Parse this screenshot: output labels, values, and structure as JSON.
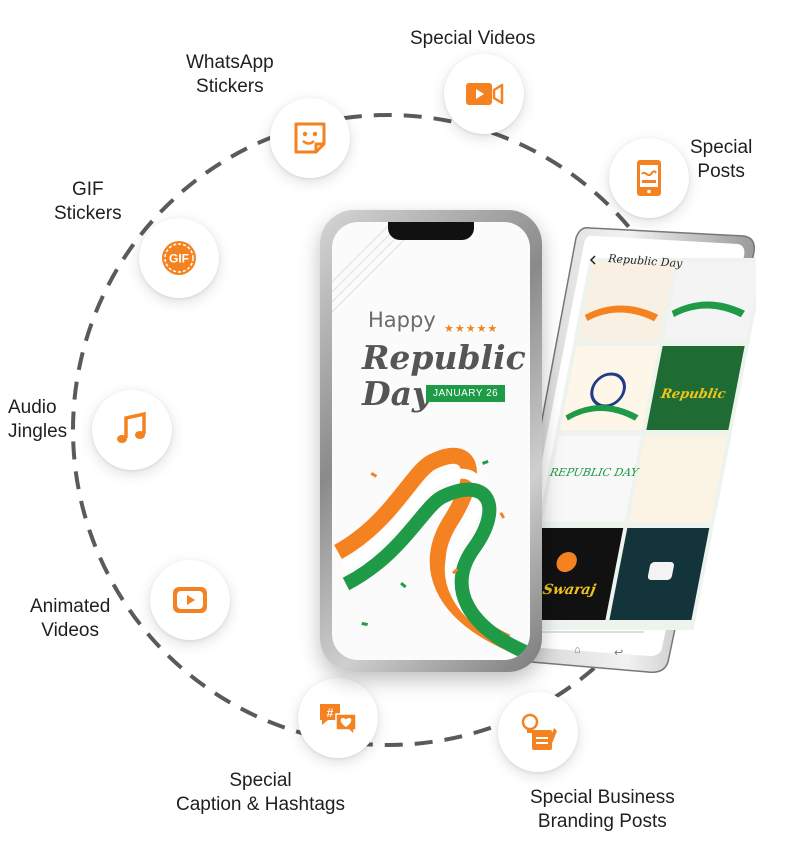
{
  "features": [
    {
      "id": "special-videos",
      "lines": [
        "Special Videos"
      ],
      "icon": "video-camera-icon"
    },
    {
      "id": "special-posts",
      "lines": [
        "Special",
        "Posts"
      ],
      "icon": "mobile-post-icon"
    },
    {
      "id": "whatsapp-stickers",
      "lines": [
        "WhatsApp",
        "Stickers"
      ],
      "icon": "sticker-icon"
    },
    {
      "id": "gif-stickers",
      "lines": [
        "GIF",
        "Stickers"
      ],
      "icon": "gif-icon"
    },
    {
      "id": "audio-jingles",
      "lines": [
        "Audio",
        "Jingles"
      ],
      "icon": "music-note-icon"
    },
    {
      "id": "animated-videos",
      "lines": [
        "Animated",
        "Videos"
      ],
      "icon": "play-video-icon"
    },
    {
      "id": "caption-hashtags",
      "lines": [
        "Special",
        "Caption & Hashtags"
      ],
      "icon": "chat-hashtag-icon"
    },
    {
      "id": "business-branding",
      "lines": [
        "Special Business",
        "Branding Posts"
      ],
      "icon": "idea-document-icon"
    }
  ],
  "front_phone": {
    "happy": "Happy",
    "republic": "Republic",
    "day": "Day",
    "date": "JANUARY 26"
  },
  "back_phone": {
    "title": "Republic Day"
  },
  "colors": {
    "accent": "#f58220",
    "green": "#1f9a47",
    "dashed_ring": "#5a5a5a"
  }
}
